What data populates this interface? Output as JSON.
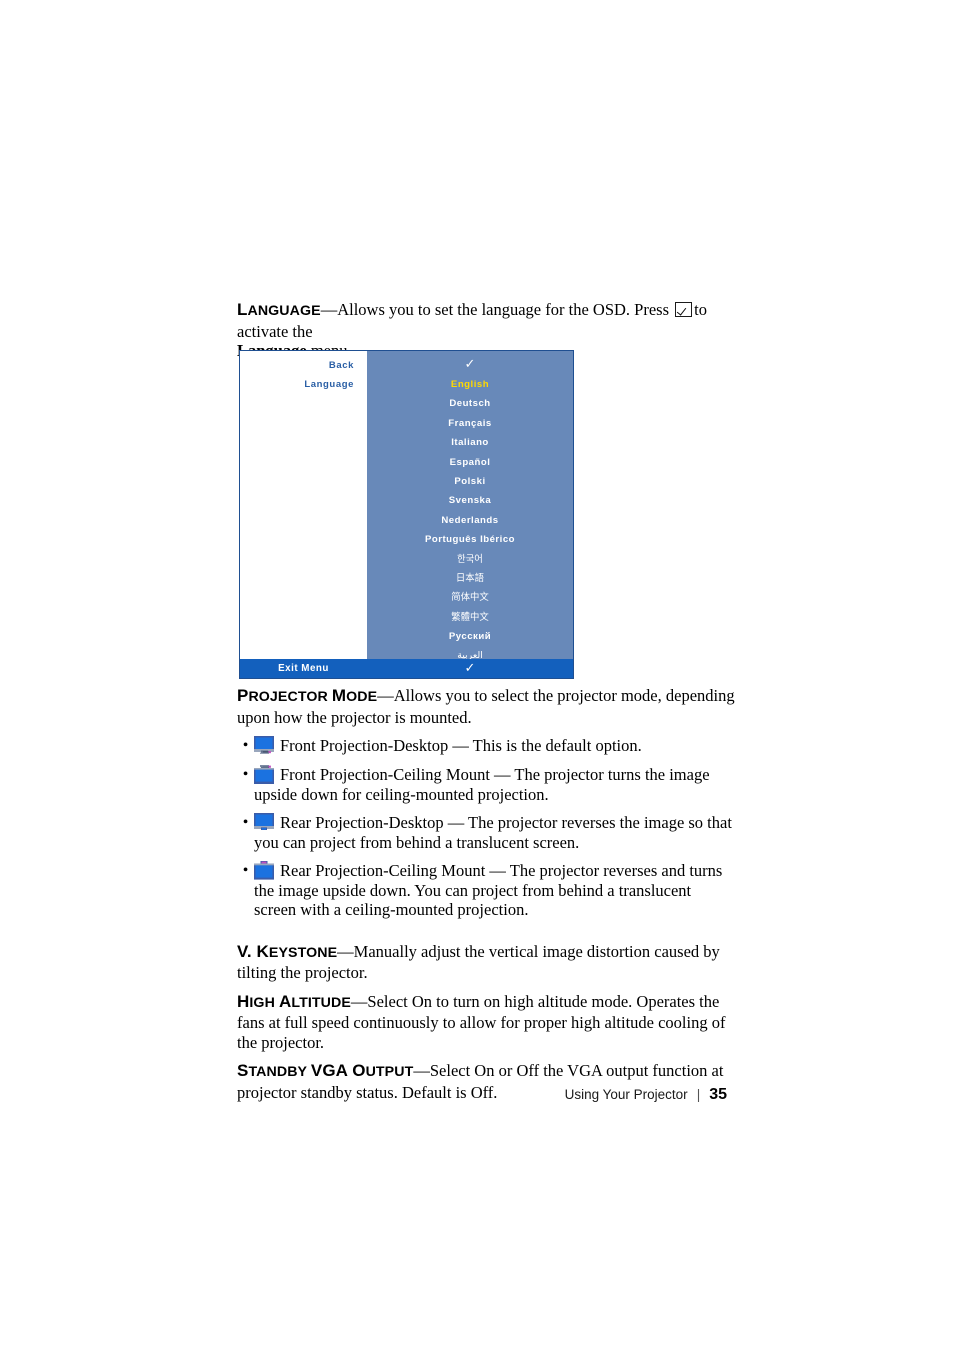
{
  "page": {
    "number": "35",
    "footer_label": "Using Your Projector",
    "footer_separator": "|"
  },
  "sections": {
    "language": {
      "term": "Language",
      "term_cap": "L",
      "term_rest": "ANGUAGE",
      "text_before_key": "—Allows you to set the language for the OSD. Press",
      "text_after_key": "to activate the",
      "line2_bold": "Language",
      "line2_rest": " menu.",
      "key_icon": "enter-check-icon"
    },
    "projector_mode": {
      "term_cap": "P",
      "term_rest": "ROJECTOR ",
      "term_cap2": "M",
      "term_rest2": "ODE",
      "description": "—Allows you to select the projector mode, depending upon how the projector is mounted.",
      "options": [
        {
          "icon": "front-projection-desktop-icon",
          "text": "Front Projection-Desktop — This is the default option."
        },
        {
          "icon": "front-projection-ceiling-icon",
          "text": "Front Projection-Ceiling Mount — The projector turns the image upside down for ceiling-mounted projection."
        },
        {
          "icon": "rear-projection-desktop-icon",
          "text": "Rear Projection-Desktop — The projector reverses the image so that you can project from behind a translucent screen."
        },
        {
          "icon": "rear-projection-ceiling-icon",
          "text": "Rear Projection-Ceiling Mount — The projector reverses and turns the image upside down. You can project from behind a translucent screen with a ceiling-mounted projection."
        }
      ]
    },
    "v_keystone": {
      "term_cap": "V. ",
      "term_cap_letter": "K",
      "term_rest": "EYSTONE",
      "description": "—Manually adjust the vertical image distortion caused by tilting the projector."
    },
    "high_altitude": {
      "term_cap": "H",
      "term_rest": "IGH ",
      "term_cap2": "A",
      "term_rest2": "LTITUDE",
      "description": "—Select On to turn on high altitude mode. Operates the fans at full speed continuously to allow for proper high altitude cooling of the projector."
    },
    "standby_vga_output": {
      "term_cap": "S",
      "term_rest": "TANDBY ",
      "term_cap2": "VGA O",
      "term_rest2": "UTPUT",
      "description": "—Select On or Off the VGA output function at projector standby status. Default is Off."
    }
  },
  "osd": {
    "colors": {
      "panel_blue": "#6889b9",
      "footer_blue": "#1360bd",
      "border_blue": "#1f4f91",
      "label_blue": "#2a5fa5",
      "selected_yellow": "#ffd900"
    },
    "left_items": [
      {
        "label": "Back"
      },
      {
        "label": "Language"
      }
    ],
    "top_check": "✓",
    "languages": [
      {
        "label": "English",
        "selected": true,
        "script": "latin"
      },
      {
        "label": "Deutsch",
        "selected": false,
        "script": "latin"
      },
      {
        "label": "Français",
        "selected": false,
        "script": "latin"
      },
      {
        "label": "Italiano",
        "selected": false,
        "script": "latin"
      },
      {
        "label": "Español",
        "selected": false,
        "script": "latin"
      },
      {
        "label": "Polski",
        "selected": false,
        "script": "latin"
      },
      {
        "label": "Svenska",
        "selected": false,
        "script": "latin"
      },
      {
        "label": "Nederlands",
        "selected": false,
        "script": "latin"
      },
      {
        "label": "Português Ibérico",
        "selected": false,
        "script": "latin"
      },
      {
        "label": "한국어",
        "selected": false,
        "script": "cjk"
      },
      {
        "label": "日本語",
        "selected": false,
        "script": "cjk"
      },
      {
        "label": "简体中文",
        "selected": false,
        "script": "cjk"
      },
      {
        "label": "繁體中文",
        "selected": false,
        "script": "cjk"
      },
      {
        "label": "Русский",
        "selected": false,
        "script": "latin"
      },
      {
        "label": "العربية",
        "selected": false,
        "script": "rtl"
      }
    ],
    "footer": {
      "label": "Exit Menu",
      "check": "✓"
    }
  }
}
